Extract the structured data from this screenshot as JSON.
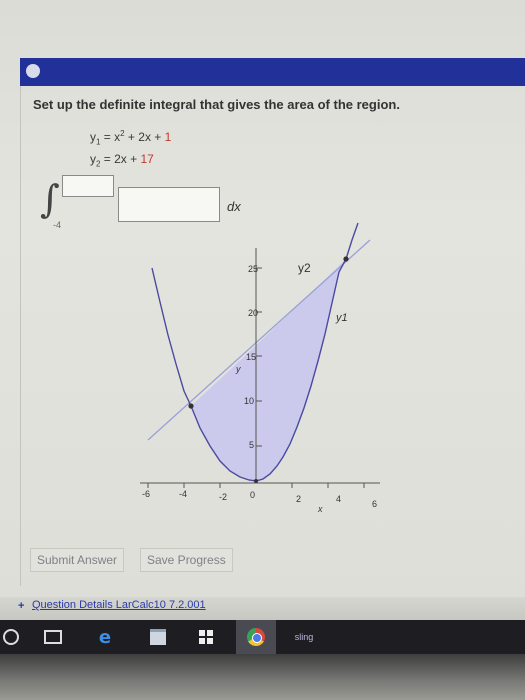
{
  "header": {
    "title": ""
  },
  "question": {
    "prompt": "Set up the definite integral that gives the area of the region.",
    "y1_label": "y",
    "y1_sub": "1",
    "y1_expr": " = x",
    "y1_exp": "2",
    "y1_mid": " + 2x + ",
    "y1_const": "1",
    "y2_label": "y",
    "y2_sub": "2",
    "y2_expr": " = 2x + ",
    "y2_const": "17"
  },
  "integral": {
    "lower_limit": "-4",
    "upper_value": "",
    "integrand_value": "",
    "differential": "dx"
  },
  "graph": {
    "x_ticks": [
      "-6",
      "-4",
      "-2",
      "0",
      "2",
      "4",
      "6"
    ],
    "y_ticks": [
      "5",
      "10",
      "15",
      "20",
      "25"
    ],
    "x_axis_label": "x",
    "y_axis_label": "y",
    "label_y2": "y2",
    "label_y1": "y1",
    "colors": {
      "parabola": "#4a4aa0",
      "line": "#9aa0d8",
      "fill": "#c7c4ee"
    }
  },
  "buttons": {
    "submit": "Submit Answer",
    "save": "Save Progress"
  },
  "details": {
    "plus": "+",
    "text": "Question Details   LarCalc10 7.2.001"
  },
  "taskbar": {
    "items": [
      "windows-icon",
      "task-view-icon",
      "edge-icon",
      "store-icon",
      "office-icon",
      "chrome-icon",
      "sling-app-icon"
    ],
    "sling_label": "sling"
  }
}
